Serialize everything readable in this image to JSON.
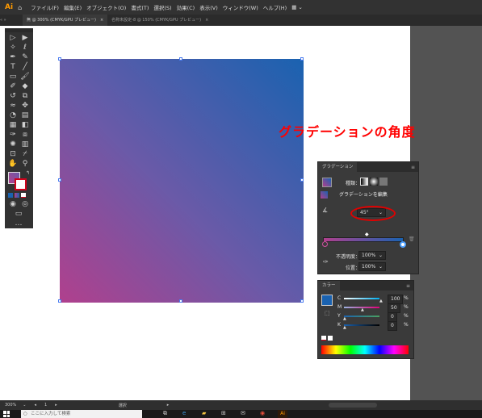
{
  "app": {
    "logo": "Ai",
    "home_icon": "home-icon"
  },
  "menu": [
    "ファイル(F)",
    "編集(E)",
    "オブジェクト(O)",
    "書式(T)",
    "選択(S)",
    "効果(C)",
    "表示(V)",
    "ウィンドウ(W)",
    "ヘルプ(H)"
  ],
  "workspace_icon": "grid-icon",
  "tabs": [
    {
      "label": "無 @ 300% (CMYK/GPU プレビュー)"
    },
    {
      "label": "名称未設定-8 @ 150% (CMYK/GPU プレビュー)"
    }
  ],
  "annotation": "グラデーションの角度",
  "gradient_panel": {
    "title": "グラデーション",
    "type_label": "種類：",
    "edit_button": "グラデーションを編集",
    "angle": "45°",
    "opacity_label": "不透明度：",
    "opacity_value": "100%",
    "location_label": "位置：",
    "location_value": "100%",
    "colors": {
      "start": "#b0408d",
      "end": "#1a62b0"
    }
  },
  "color_panel": {
    "title": "カラー",
    "swatch": "#1a62b0",
    "channels": [
      {
        "name": "C",
        "value": "100",
        "unit": "%"
      },
      {
        "name": "M",
        "value": "50",
        "unit": "%"
      },
      {
        "name": "Y",
        "value": "0",
        "unit": "%"
      },
      {
        "name": "K",
        "value": "0",
        "unit": "%"
      }
    ]
  },
  "status": {
    "zoom": "300%",
    "page": "1",
    "mode": "選択"
  },
  "taskbar": {
    "search_placeholder": "ここに入力して検索"
  }
}
